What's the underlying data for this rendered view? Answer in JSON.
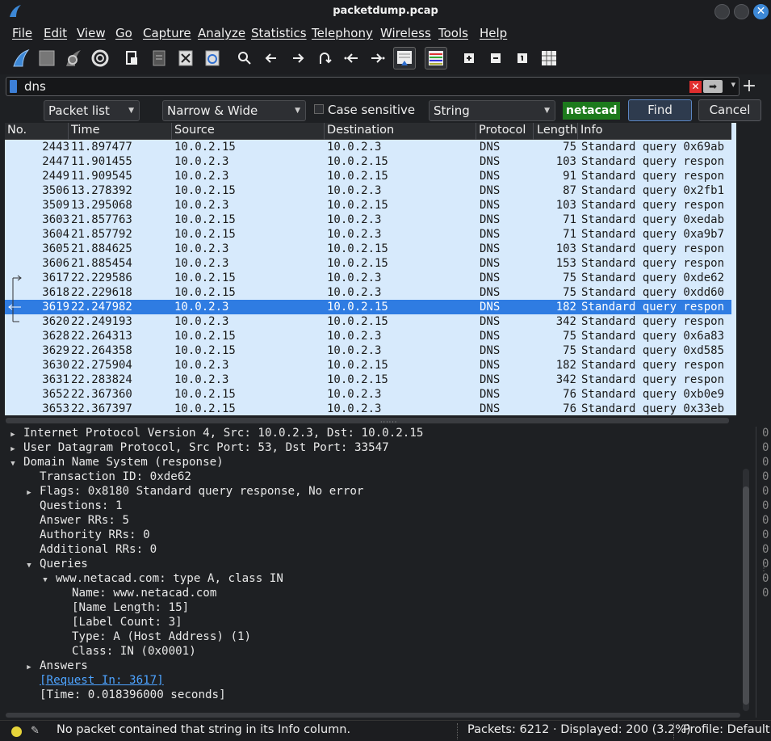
{
  "window": {
    "title": "packetdump.pcap",
    "close_glyph": "✕"
  },
  "menu": [
    "File",
    "Edit",
    "View",
    "Go",
    "Capture",
    "Analyze",
    "Statistics",
    "Telephony",
    "Wireless",
    "Tools",
    "Help"
  ],
  "toolbar_icons": [
    "shark-fin-start-icon",
    "stop-capture-icon",
    "restart-capture-icon",
    "capture-options-icon",
    "open-file-icon",
    "save-file-icon",
    "close-file-icon",
    "reload-file-icon",
    "find-packet-icon",
    "go-back-icon",
    "go-forward-icon",
    "go-to-packet-icon",
    "first-packet-icon",
    "last-packet-icon",
    "autoscroll-icon",
    "colorize-icon",
    "zoom-in-icon",
    "zoom-out-icon",
    "normal-size-icon",
    "resize-columns-icon"
  ],
  "filter": {
    "value": "dns",
    "clear_glyph": "✕",
    "apply_glyph": "➡",
    "dropdown_glyph": "▾",
    "add_glyph": "+"
  },
  "find": {
    "search_in": "Packet list",
    "char_width": "Narrow & Wide",
    "case_sensitive_label": "Case sensitive",
    "search_type": "String",
    "search_text": "netacad",
    "find_label": "Find",
    "cancel_label": "Cancel",
    "dropdown_glyph": "▼"
  },
  "packet_list": {
    "columns": [
      "No.",
      "Time",
      "Source",
      "Destination",
      "Protocol",
      "Length",
      "Info"
    ],
    "selected_index": 11,
    "rows": [
      {
        "no": "2443",
        "time": "11.897477",
        "src": "10.0.2.15",
        "dst": "10.0.2.3",
        "proto": "DNS",
        "len": "75",
        "info": "Standard query 0x69ab"
      },
      {
        "no": "2447",
        "time": "11.901455",
        "src": "10.0.2.3",
        "dst": "10.0.2.15",
        "proto": "DNS",
        "len": "103",
        "info": "Standard query respon"
      },
      {
        "no": "2449",
        "time": "11.909545",
        "src": "10.0.2.3",
        "dst": "10.0.2.15",
        "proto": "DNS",
        "len": "91",
        "info": "Standard query respon"
      },
      {
        "no": "3506",
        "time": "13.278392",
        "src": "10.0.2.15",
        "dst": "10.0.2.3",
        "proto": "DNS",
        "len": "87",
        "info": "Standard query 0x2fb1"
      },
      {
        "no": "3509",
        "time": "13.295068",
        "src": "10.0.2.3",
        "dst": "10.0.2.15",
        "proto": "DNS",
        "len": "103",
        "info": "Standard query respon"
      },
      {
        "no": "3603",
        "time": "21.857763",
        "src": "10.0.2.15",
        "dst": "10.0.2.3",
        "proto": "DNS",
        "len": "71",
        "info": "Standard query 0xedab"
      },
      {
        "no": "3604",
        "time": "21.857792",
        "src": "10.0.2.15",
        "dst": "10.0.2.3",
        "proto": "DNS",
        "len": "71",
        "info": "Standard query 0xa9b7"
      },
      {
        "no": "3605",
        "time": "21.884625",
        "src": "10.0.2.3",
        "dst": "10.0.2.15",
        "proto": "DNS",
        "len": "103",
        "info": "Standard query respon"
      },
      {
        "no": "3606",
        "time": "21.885454",
        "src": "10.0.2.3",
        "dst": "10.0.2.15",
        "proto": "DNS",
        "len": "153",
        "info": "Standard query respon"
      },
      {
        "no": "3617",
        "time": "22.229586",
        "src": "10.0.2.15",
        "dst": "10.0.2.3",
        "proto": "DNS",
        "len": "75",
        "info": "Standard query 0xde62"
      },
      {
        "no": "3618",
        "time": "22.229618",
        "src": "10.0.2.15",
        "dst": "10.0.2.3",
        "proto": "DNS",
        "len": "75",
        "info": "Standard query 0xdd60"
      },
      {
        "no": "3619",
        "time": "22.247982",
        "src": "10.0.2.3",
        "dst": "10.0.2.15",
        "proto": "DNS",
        "len": "182",
        "info": "Standard query respon"
      },
      {
        "no": "3620",
        "time": "22.249193",
        "src": "10.0.2.3",
        "dst": "10.0.2.15",
        "proto": "DNS",
        "len": "342",
        "info": "Standard query respon"
      },
      {
        "no": "3628",
        "time": "22.264313",
        "src": "10.0.2.15",
        "dst": "10.0.2.3",
        "proto": "DNS",
        "len": "75",
        "info": "Standard query 0x6a83"
      },
      {
        "no": "3629",
        "time": "22.264358",
        "src": "10.0.2.15",
        "dst": "10.0.2.3",
        "proto": "DNS",
        "len": "75",
        "info": "Standard query 0xd585"
      },
      {
        "no": "3630",
        "time": "22.275904",
        "src": "10.0.2.3",
        "dst": "10.0.2.15",
        "proto": "DNS",
        "len": "182",
        "info": "Standard query respon"
      },
      {
        "no": "3631",
        "time": "22.283824",
        "src": "10.0.2.3",
        "dst": "10.0.2.15",
        "proto": "DNS",
        "len": "342",
        "info": "Standard query respon"
      },
      {
        "no": "3652",
        "time": "22.367360",
        "src": "10.0.2.15",
        "dst": "10.0.2.3",
        "proto": "DNS",
        "len": "76",
        "info": "Standard query 0xb0e9"
      },
      {
        "no": "3653",
        "time": "22.367397",
        "src": "10.0.2.15",
        "dst": "10.0.2.3",
        "proto": "DNS",
        "len": "76",
        "info": "Standard query 0x33eb"
      }
    ]
  },
  "details": [
    {
      "indent": 0,
      "expander": "collapsed",
      "text": "Internet Protocol Version 4, Src: 10.0.2.3, Dst: 10.0.2.15"
    },
    {
      "indent": 0,
      "expander": "collapsed",
      "text": "User Datagram Protocol, Src Port: 53, Dst Port: 33547"
    },
    {
      "indent": 0,
      "expander": "expanded",
      "text": "Domain Name System (response)"
    },
    {
      "indent": 1,
      "expander": "none",
      "text": "Transaction ID: 0xde62"
    },
    {
      "indent": 1,
      "expander": "collapsed",
      "text": "Flags: 0x8180 Standard query response, No error"
    },
    {
      "indent": 1,
      "expander": "none",
      "text": "Questions: 1"
    },
    {
      "indent": 1,
      "expander": "none",
      "text": "Answer RRs: 5"
    },
    {
      "indent": 1,
      "expander": "none",
      "text": "Authority RRs: 0"
    },
    {
      "indent": 1,
      "expander": "none",
      "text": "Additional RRs: 0"
    },
    {
      "indent": 1,
      "expander": "expanded",
      "text": "Queries"
    },
    {
      "indent": 2,
      "expander": "expanded",
      "text": "www.netacad.com: type A, class IN"
    },
    {
      "indent": 3,
      "expander": "none",
      "text": "Name: www.netacad.com"
    },
    {
      "indent": 3,
      "expander": "none",
      "text": "[Name Length: 15]"
    },
    {
      "indent": 3,
      "expander": "none",
      "text": "[Label Count: 3]"
    },
    {
      "indent": 3,
      "expander": "none",
      "text": "Type: A (Host Address) (1)"
    },
    {
      "indent": 3,
      "expander": "none",
      "text": "Class: IN (0x0001)"
    },
    {
      "indent": 1,
      "expander": "collapsed",
      "text": "Answers"
    },
    {
      "indent": 1,
      "expander": "none",
      "text": "[Request In: 3617]",
      "link": true
    },
    {
      "indent": 1,
      "expander": "none",
      "text": "[Time: 0.018396000 seconds]"
    }
  ],
  "bytes_pane": [
    "0",
    "0",
    "0",
    "0",
    "0",
    "0",
    "0",
    "0",
    "0",
    "0",
    "0",
    "0"
  ],
  "status": {
    "message": "No packet contained that string in its Info column.",
    "packets": "Packets: 6212 · Displayed: 200 (3.2%)",
    "profile": "Profile: Default"
  },
  "colors": {
    "accent": "#2f7ce2",
    "row_bg": "#d7eafc",
    "search_bg": "#1c7a1c",
    "link": "#4da3ff"
  }
}
